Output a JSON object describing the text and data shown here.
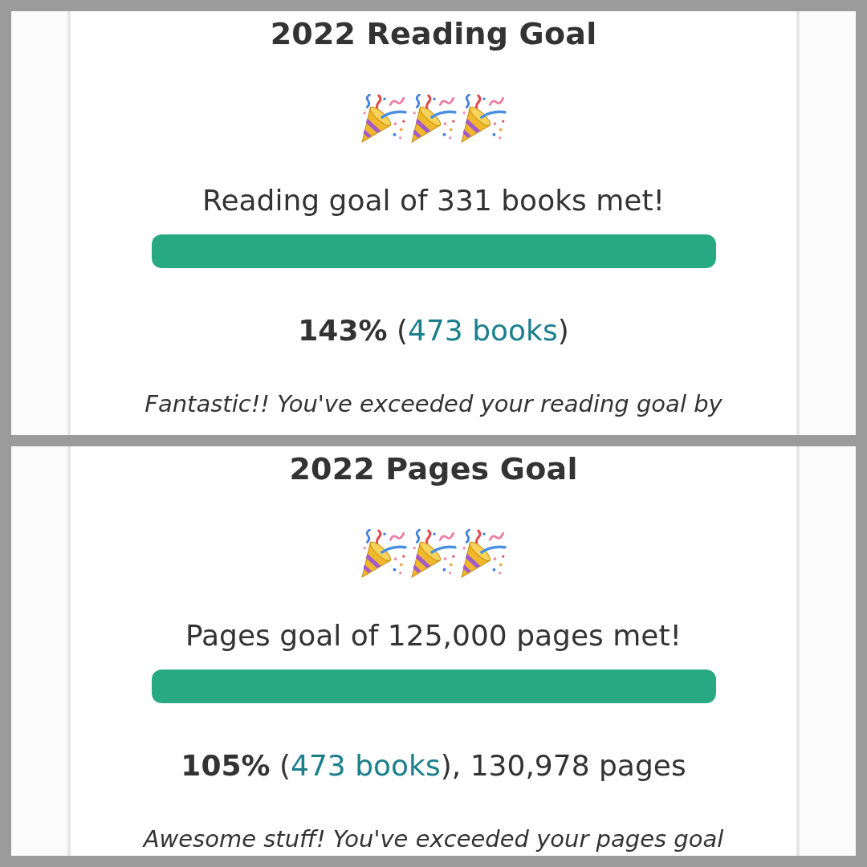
{
  "panels": [
    {
      "title": "2022 Reading Goal",
      "goal_met": true,
      "goal_text": "Reading goal of 331 books met!",
      "progress": {
        "level": 1
      },
      "summary": {
        "percent": "143%",
        "open": "(",
        "link": "473 books",
        "close": ")"
      },
      "message": "Fantastic!! You've exceeded your reading goal by"
    },
    {
      "title": "2022 Pages Goal",
      "goal_met": true,
      "goal_text": "Pages goal of 125,000 pages met!",
      "progress": {
        "level": 1
      },
      "summary": {
        "percent": "105%",
        "open": "(",
        "link": "473 books",
        "close": "), 130,978 pages"
      },
      "message": "Awesome stuff! You've exceeded your pages goal"
    }
  ]
}
